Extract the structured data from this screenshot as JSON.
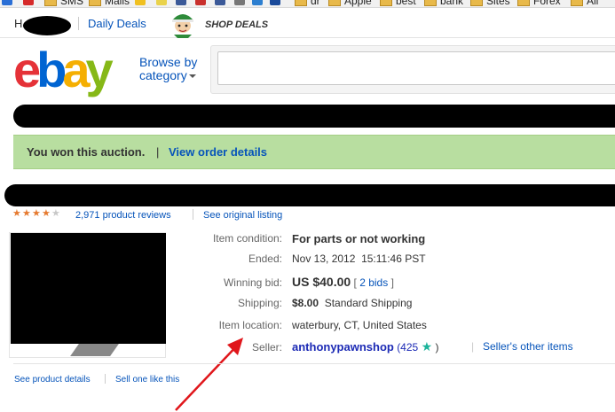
{
  "bookmarks": [
    {
      "label": "SMS"
    },
    {
      "label": "Mails"
    },
    {
      "label": "dr"
    },
    {
      "label": "Apple"
    },
    {
      "label": "best"
    },
    {
      "label": "bank"
    },
    {
      "label": "Sites"
    },
    {
      "label": "Forex"
    },
    {
      "label": "All"
    }
  ],
  "topnav": {
    "home_letter": "H",
    "daily_deals": "Daily Deals",
    "shop_deals": "SHOP DEALS"
  },
  "header": {
    "logo_letters": [
      "e",
      "b",
      "a",
      "y"
    ],
    "browse_line1": "Browse by",
    "browse_line2": "category"
  },
  "banner": {
    "message": "You won this auction.",
    "separator": "|",
    "order_link": "View order details"
  },
  "reviews": {
    "rating_stars": 4,
    "max_stars": 5,
    "count_text": "2,971 product reviews",
    "original_listing": "See original listing"
  },
  "details": {
    "condition_label": "Item condition:",
    "condition_value": "For parts or not working",
    "ended_label": "Ended:",
    "ended_date": "Nov 13, 2012",
    "ended_time": "15:11:46 PST",
    "winning_bid_label": "Winning bid:",
    "winning_bid_value": "US $40.00",
    "bids_open": "[",
    "bids_link": "2 bids",
    "bids_close": "]",
    "shipping_label": "Shipping:",
    "shipping_price": "$8.00",
    "shipping_method": "Standard Shipping",
    "location_label": "Item location:",
    "location_value": "waterbury, CT, United States",
    "seller_label": "Seller:",
    "seller_name": "anthonypawnshop",
    "seller_score_open": "(425",
    "seller_score_close": ")",
    "seller_sep": "|",
    "seller_other_items": "Seller's other items"
  },
  "footer": {
    "see_product_details": "See product details",
    "sell_one_like_this": "Sell one like this"
  },
  "colors": {
    "banner_bg": "#b8dea0",
    "link": "#0654ba",
    "seller_name": "#1c2ab5",
    "arrow": "#e0161b",
    "rating_star": "#e67a30"
  }
}
